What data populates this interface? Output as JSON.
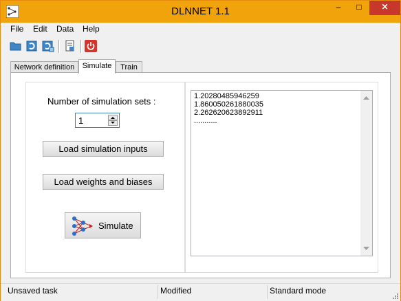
{
  "window": {
    "title": "DLNNET 1.1",
    "min_glyph": "‒",
    "max_glyph": "□",
    "close_glyph": "✕"
  },
  "menu": [
    "File",
    "Edit",
    "Data",
    "Help"
  ],
  "toolbar": {
    "icons": [
      "open-folder-icon",
      "save-icon",
      "save-as-icon",
      "print-preview-icon",
      "power-icon"
    ]
  },
  "tabs": [
    {
      "label": "Network definition",
      "active": false
    },
    {
      "label": "Simulate",
      "active": true
    },
    {
      "label": "Train",
      "active": false
    }
  ],
  "simulate": {
    "sets_label": "Number of simulation sets :",
    "sets_value": "1",
    "load_inputs_label": "Load simulation inputs",
    "load_weights_label": "Load weights and biases",
    "simulate_label": "Simulate",
    "output_lines": [
      "1.20280485946259",
      "1.860050261880035",
      "2.262620623892911",
      "..........."
    ]
  },
  "status": [
    "Unsaved task",
    "Modified",
    "Standard mode"
  ],
  "colors": {
    "titlebar": "#f0a30a",
    "close": "#c7372c",
    "accent": "#3c7fb1"
  }
}
